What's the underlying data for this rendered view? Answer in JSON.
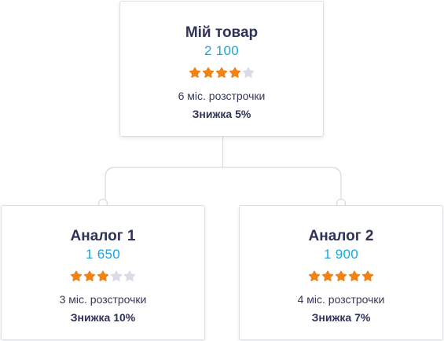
{
  "cards": [
    {
      "id": "main",
      "title": "Мій товар",
      "price": "2 100",
      "rating": 4,
      "max_rating": 5,
      "installments": "6 міс. розстрочки",
      "discount": "Знижка 5%"
    },
    {
      "id": "analog-1",
      "title": "Аналог 1",
      "price": "1 650",
      "rating": 3,
      "max_rating": 5,
      "installments": "3 міс. розстрочки",
      "discount": "Знижка 10%"
    },
    {
      "id": "analog-2",
      "title": "Аналог 2",
      "price": "1 900",
      "rating": 5,
      "max_rating": 5,
      "installments": "4 міс. розстрочки",
      "discount": "Знижка 7%"
    }
  ],
  "colors": {
    "title": "#2f3357",
    "price": "#1ba4e0",
    "star_filled": "#f08216",
    "star_empty": "#dadbe7",
    "connector": "#d8d9e2"
  },
  "icons": {
    "star": "star-icon"
  }
}
